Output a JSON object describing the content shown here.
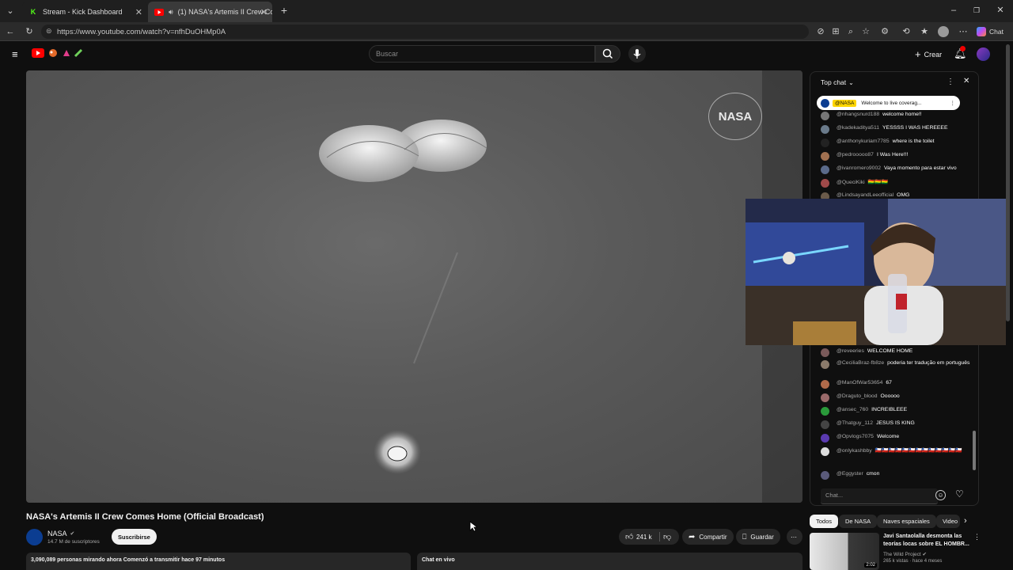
{
  "browser": {
    "tabs": [
      {
        "label": "Stream - Kick Dashboard",
        "icon": "kick-logo-icon"
      },
      {
        "label": "(1) NASA's Artemis II Crew Co",
        "icon": "youtube-logo-icon"
      }
    ],
    "url": "https://www.youtube.com/watch?v=nfhDuOHMp0A",
    "chat_button": "Chat"
  },
  "youtube": {
    "search_placeholder": "Buscar",
    "create_label": "Crear"
  },
  "video": {
    "watermark": "NASA",
    "title": "NASA's Artemis II Crew Comes Home (Official Broadcast)",
    "channel": "NASA",
    "subscribers": "14.7 M de suscriptores",
    "subscribe_label": "Suscribirse",
    "likes": "241 k",
    "share_label": "Compartir",
    "save_label": "Guardar",
    "watching": "3,090,089 personas mirando ahora  Comenzó a transmitir hace 97 minutos",
    "live_chat_label": "Chat en vivo"
  },
  "chat": {
    "header": "Top chat",
    "pinned_author": "@NASA",
    "pinned_text": "Welcome to live coverag...",
    "messages_top": [
      {
        "author": "@nhangsnurd188",
        "text": "welcome home!!",
        "color": "#777"
      },
      {
        "author": "@kadekaditya511",
        "text": "YESSSS I WAS HEREEEE",
        "color": "#6a7a8a"
      },
      {
        "author": "@anthonykuriam7785",
        "text": "where is the toilet",
        "color": "#222"
      },
      {
        "author": "@pedrooooo87",
        "text": "I Was Here!!!",
        "color": "#a07050"
      },
      {
        "author": "@ivanromero9002",
        "text": "Vaya momento para estar vivo",
        "color": "#5a6a8a"
      },
      {
        "author": "@QueciKiki",
        "text": "🇧🇴🇧🇴🇧🇴",
        "color": "#a04a4a"
      },
      {
        "author": "@LindsayandLeeofficial",
        "text": "OMG",
        "color": "#6a5a4a"
      }
    ],
    "messages_bottom": [
      {
        "author": "@reveeries",
        "text": "WELCOME HOME",
        "color": "#7a5a5a"
      },
      {
        "author": "@CeciliaBraz-fb8ze",
        "text": "poderia ter tradução em português",
        "color": "#8a7a6a"
      },
      {
        "author": "@ManOfWar53654",
        "text": "67",
        "color": "#b06a4a"
      },
      {
        "author": "@Draguto_blood",
        "text": "Oooooo",
        "color": "#9a6a6a"
      },
      {
        "author": "@ansec_760",
        "text": "INCREIBLEEE",
        "color": "#2a9a3a"
      },
      {
        "author": "@Thatguy_112",
        "text": "JESUS IS KING",
        "color": "#444"
      },
      {
        "author": "@Opvlogs7075",
        "text": "Welcome",
        "color": "#5a3ab0"
      },
      {
        "author": "@onlykashbby",
        "text": "🇨🇱🇨🇱🇨🇱🇨🇱🇨🇱🇨🇱🇨🇱🇨🇱🇨🇱🇨🇱🇨🇱🇨🇱🇨🇱",
        "color": "#ddd"
      },
      {
        "author": "@Eggyster",
        "text": "cmon",
        "color": "#5a5a7a"
      }
    ],
    "input_placeholder": "Chat...",
    "avatar_letter": "D"
  },
  "recommendations": {
    "chips": [
      "Todos",
      "De NASA",
      "Naves espaciales",
      "Video"
    ],
    "item": {
      "title": "Javi Santaolalla desmonta las teorías locas sobre EL HOMBR...",
      "channel": "The Wild Project",
      "meta": "265 k vistas · hace 4 meses",
      "duration": "2:02"
    }
  }
}
